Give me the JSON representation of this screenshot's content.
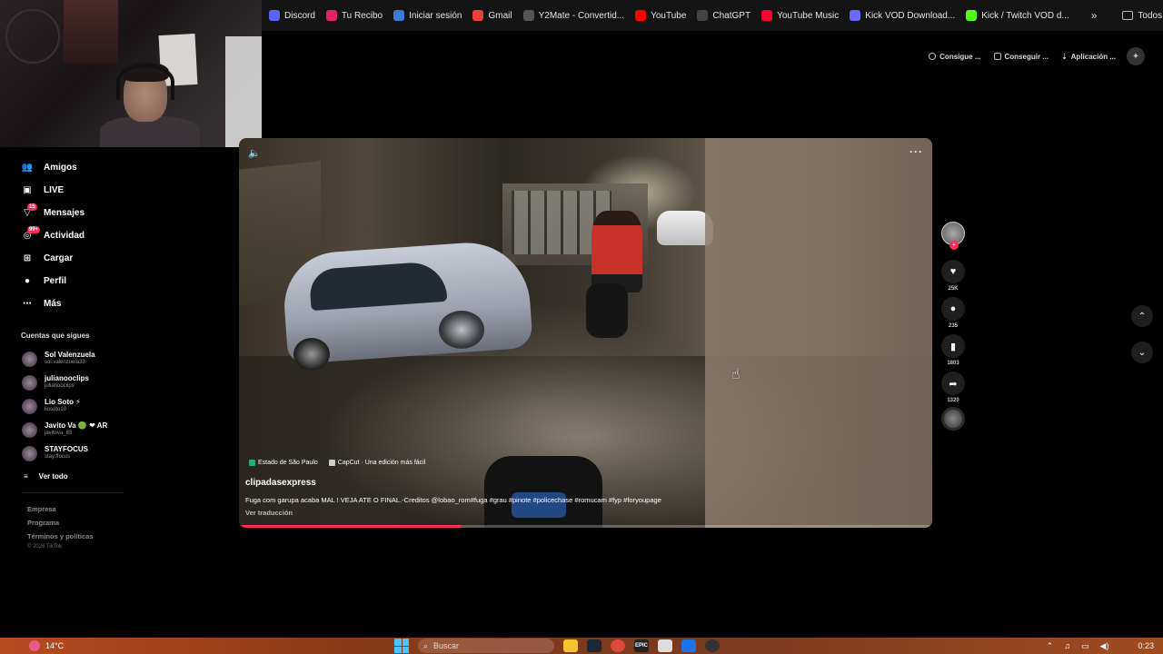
{
  "bookmarks": [
    {
      "label": "Discord",
      "icon": "discord-icon",
      "color": "#5865f2"
    },
    {
      "label": "Tu Recibo",
      "icon": "receipt-icon",
      "color": "#e0245e"
    },
    {
      "label": "Iniciar sesión",
      "icon": "login-icon",
      "color": "#3a7bd5"
    },
    {
      "label": "Gmail",
      "icon": "gmail-icon",
      "color": "#ea4335"
    },
    {
      "label": "Y2Mate - Convertid...",
      "icon": "y2mate-icon",
      "color": "#555555"
    },
    {
      "label": "YouTube",
      "icon": "youtube-icon",
      "color": "#ff0000"
    },
    {
      "label": "ChatGPT",
      "icon": "chatgpt-icon",
      "color": "#444444"
    },
    {
      "label": "YouTube Music",
      "icon": "youtube-music-icon",
      "color": "#ff0033"
    },
    {
      "label": "Kick VOD Download...",
      "icon": "kick-vod-icon",
      "color": "#6a6aff"
    },
    {
      "label": "Kick / Twitch VOD d...",
      "icon": "kick-icon",
      "color": "#53fc18"
    }
  ],
  "bookmarks_all": "Todos los marcadores",
  "top_actions": [
    {
      "label": "Consigue ...",
      "icon": "coin-icon"
    },
    {
      "label": "Conseguir ...",
      "icon": "device-icon"
    },
    {
      "label": "Aplicación ...",
      "icon": "download-icon"
    }
  ],
  "sidebar": {
    "nav": [
      {
        "label": "Amigos",
        "icon": "friends-icon",
        "glyph": "👥",
        "badge": ""
      },
      {
        "label": "LIVE",
        "icon": "live-icon",
        "glyph": "▣",
        "badge": ""
      },
      {
        "label": "Mensajes",
        "icon": "messages-icon",
        "glyph": "▽",
        "badge": "15"
      },
      {
        "label": "Actividad",
        "icon": "activity-icon",
        "glyph": "◎",
        "badge": "99+"
      },
      {
        "label": "Cargar",
        "icon": "upload-icon",
        "glyph": "⊞",
        "badge": ""
      },
      {
        "label": "Perfil",
        "icon": "profile-icon",
        "glyph": "●",
        "badge": ""
      },
      {
        "label": "Más",
        "icon": "more-icon",
        "glyph": "⋯",
        "badge": ""
      }
    ],
    "following_title": "Cuentas que sigues",
    "accounts": [
      {
        "name": "Sol Valenzuela",
        "handle": "sol.valenzuela33"
      },
      {
        "name": "julianooclips",
        "handle": "julianooclips"
      },
      {
        "name": "Lio Soto ⚡",
        "handle": "liosoto10"
      },
      {
        "name": "Javito Va 🟢 ❤ AR",
        "handle": "javitova_65"
      },
      {
        "name": "STAYFOCUS",
        "handle": "stay.ffocus"
      }
    ],
    "see_all": "Ver todo",
    "footer": [
      "Empresa",
      "Programa",
      "Términos y políticas"
    ],
    "copyright": "© 2026 TikTok"
  },
  "video": {
    "tags": [
      "Estado de São Paulo",
      "CapCut · Una edición más fácil"
    ],
    "author": "clipadasexpress",
    "description": "Fuga com garupa acaba MAL ! VEJA ATE O FINAL.-Creditos @lobao_rom#fuga #grau #pinote #policechase #romucam #fyp #foryoupage",
    "translate": "Ver traducción",
    "progress": 0.32
  },
  "actions": {
    "likes": "25K",
    "comments": "235",
    "saves": "1803",
    "shares": "1320"
  },
  "taskbar": {
    "weather": "14°C",
    "search": "Buscar",
    "clock": "0:23"
  }
}
